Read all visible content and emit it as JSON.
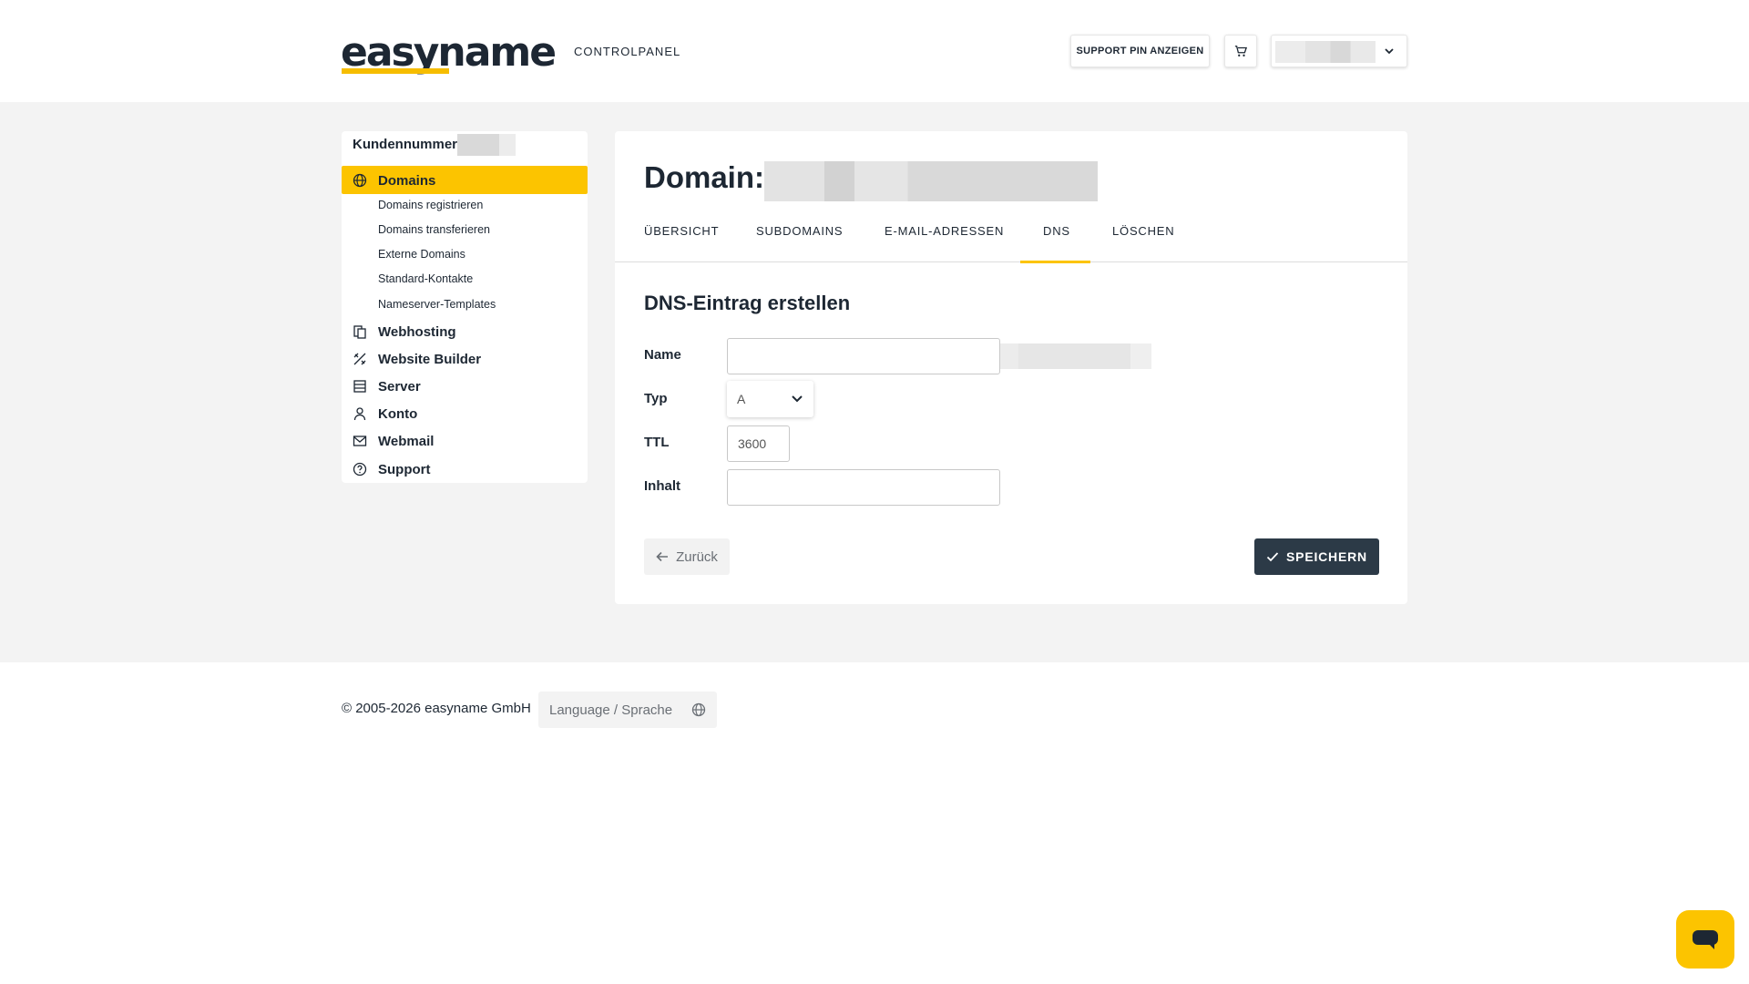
{
  "header": {
    "logo_text": "easyname",
    "controlpanel_label": "CONTROLPANEL",
    "support_pin_label": "SUPPORT PIN ANZEIGEN",
    "cart_icon": "cart-icon",
    "user_menu_icon": "chevron-down-icon"
  },
  "sidebar": {
    "customer_number_label": "Kundennummer:",
    "items": [
      {
        "label": "Domains",
        "icon": "globe-icon",
        "active": true
      },
      {
        "label": "Webhosting",
        "icon": "file-copy-icon"
      },
      {
        "label": "Website Builder",
        "icon": "tools-icon"
      },
      {
        "label": "Server",
        "icon": "server-icon"
      },
      {
        "label": "Konto",
        "icon": "user-icon"
      },
      {
        "label": "Webmail",
        "icon": "mail-icon"
      },
      {
        "label": "Support",
        "icon": "help-circle-icon"
      }
    ],
    "sub_items": [
      "Domains registrieren",
      "Domains transferieren",
      "Externe Domains",
      "Standard-Kontakte",
      "Nameserver-Templates"
    ]
  },
  "main": {
    "domain_label": "Domain:",
    "tabs": [
      "ÜBERSICHT",
      "SUBDOMAINS",
      "E-MAIL-ADRESSEN",
      "DNS",
      "LÖSCHEN"
    ],
    "active_tab": "DNS",
    "form": {
      "title": "DNS-Eintrag erstellen",
      "name_label": "Name",
      "name_value": "",
      "type_label": "Typ",
      "type_value": "A",
      "ttl_label": "TTL",
      "ttl_value": "3600",
      "content_label": "Inhalt",
      "content_value": ""
    },
    "back_label": "Zurück",
    "save_label": "SPEICHERN"
  },
  "footer": {
    "copyright": "© 2005-2026 easyname GmbH",
    "language_label": "Language / Sprache"
  },
  "colors": {
    "accent": "#fcc400",
    "dark": "#2c3a47",
    "background": "#f3f3f3"
  }
}
